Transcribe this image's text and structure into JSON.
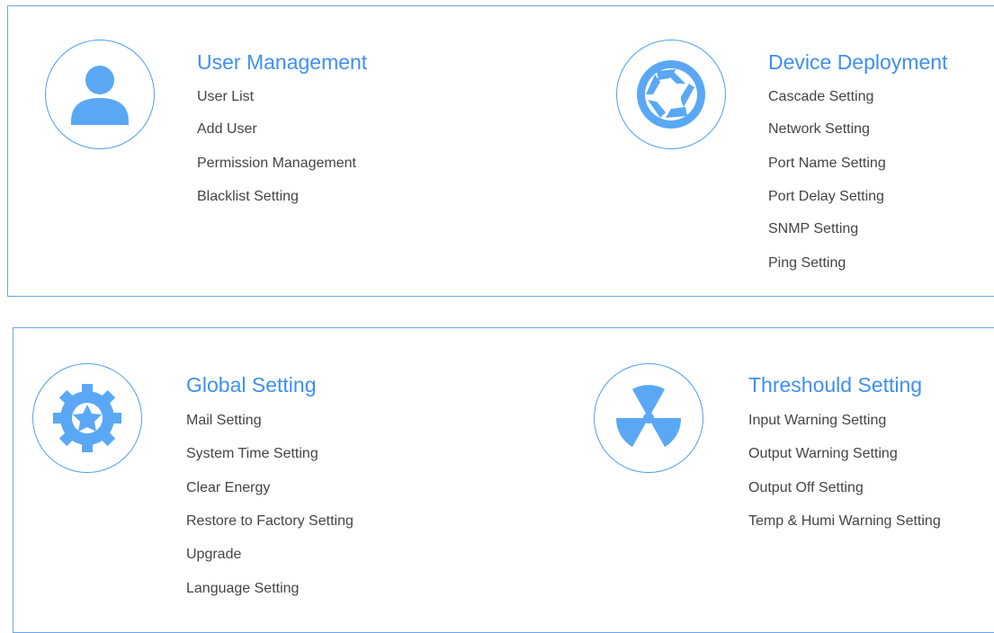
{
  "sections": [
    {
      "title": "User Management",
      "icon": "user-icon",
      "items": [
        "User List",
        "Add User",
        "Permission Management",
        "Blacklist Setting"
      ]
    },
    {
      "title": "Device Deployment",
      "icon": "aperture-icon",
      "items": [
        "Cascade Setting",
        "Network Setting",
        "Port Name Setting",
        "Port Delay Setting",
        "SNMP Setting",
        "Ping Setting"
      ]
    },
    {
      "title": "Global Setting",
      "icon": "gear-icon",
      "items": [
        "Mail Setting",
        "System Time Setting",
        "Clear Energy",
        "Restore to Factory Setting",
        "Upgrade",
        "Language Setting"
      ]
    },
    {
      "title": "Threshould Setting",
      "icon": "fan-icon",
      "items": [
        "Input Warning Setting",
        "Output Warning Setting",
        "Output Off Setting",
        "Temp & Humi Warning Setting"
      ]
    }
  ],
  "colors": {
    "accent": "#3f8ff0",
    "icon_fill": "#5aa8f5",
    "border": "#6aa6e6",
    "text": "#444444"
  }
}
